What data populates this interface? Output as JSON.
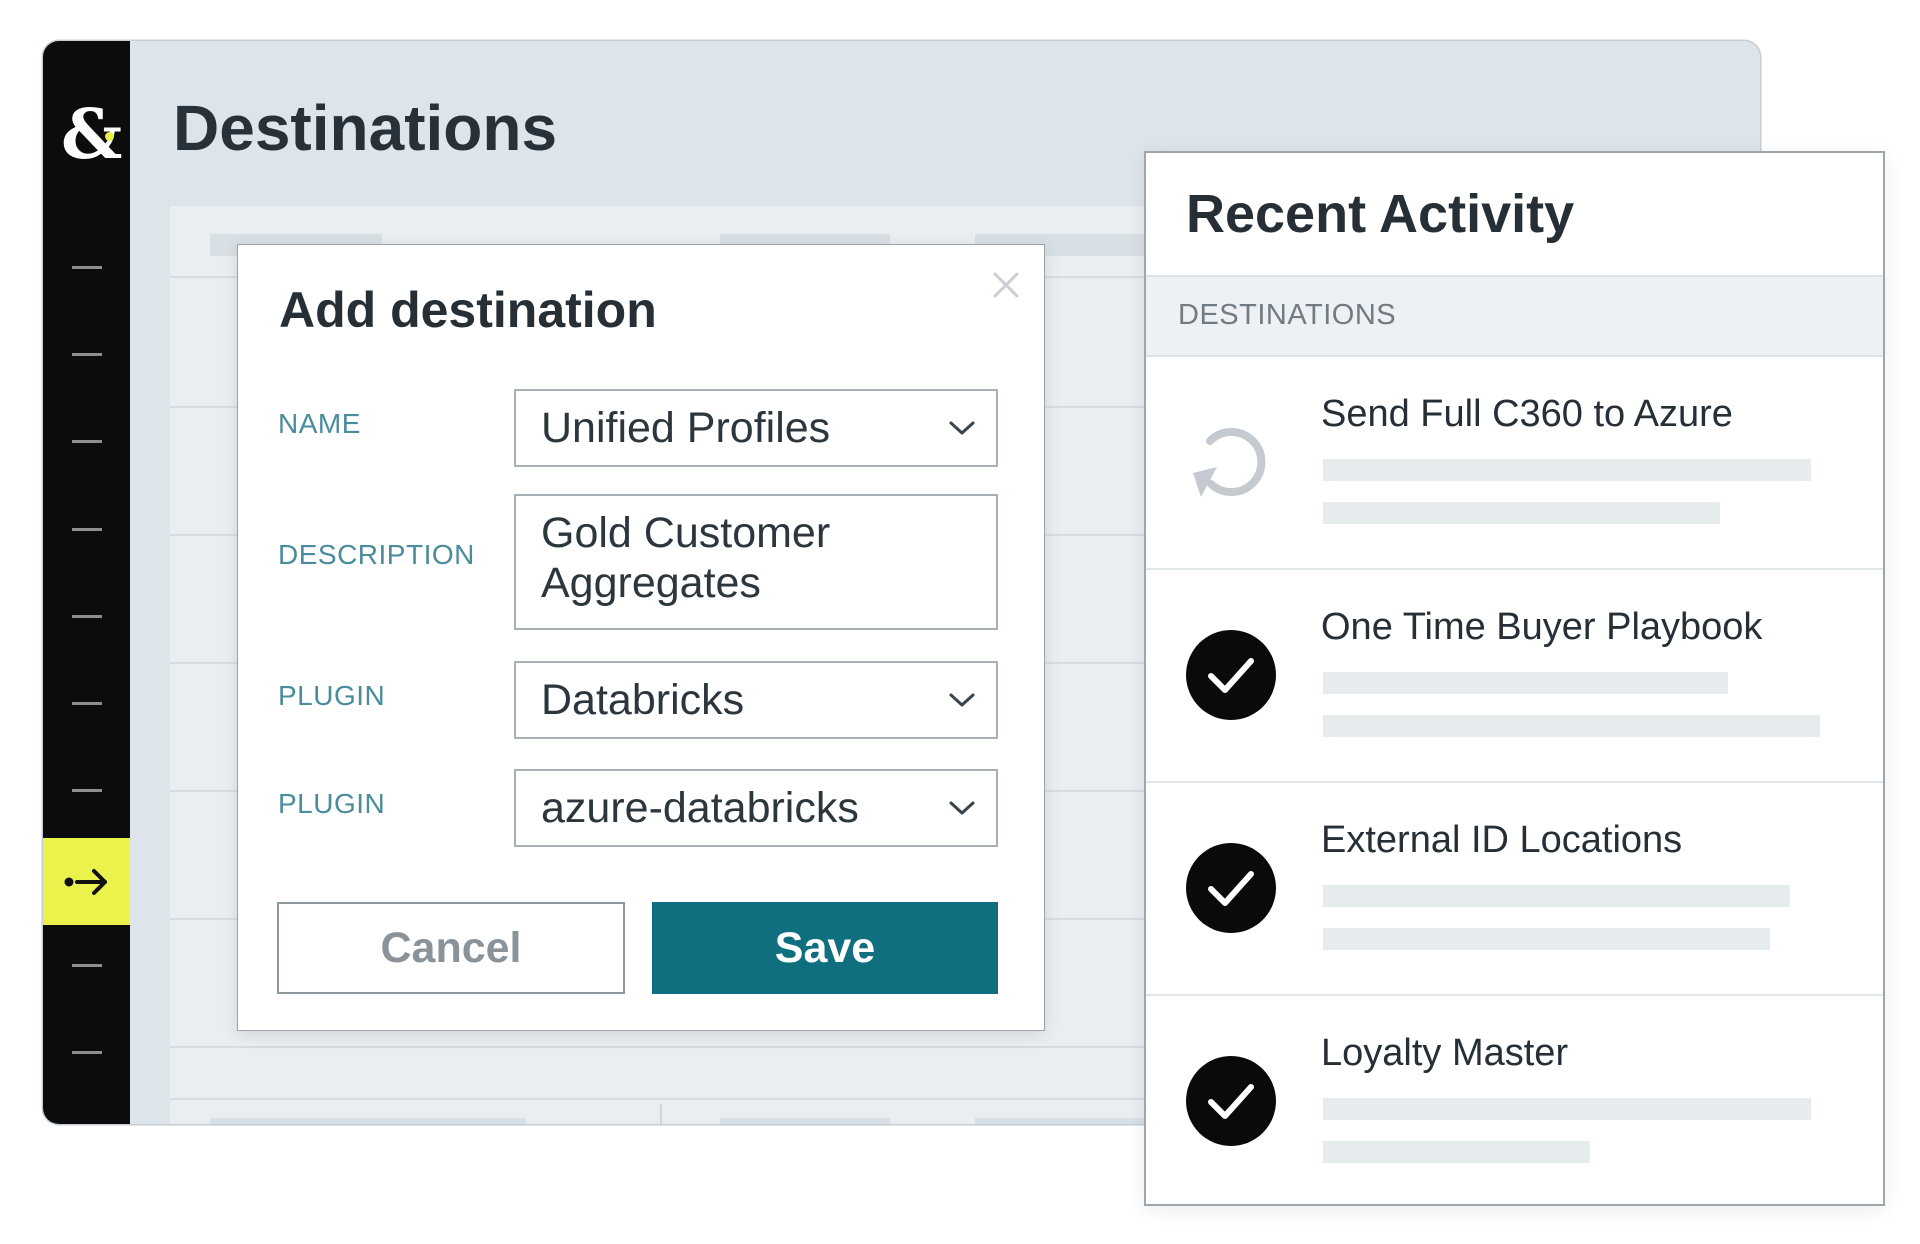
{
  "app": {
    "page_title": "Destinations",
    "logo_text": "&"
  },
  "sidebar": {
    "active_icon": "arrow-right-icon"
  },
  "modal": {
    "title": "Add destination",
    "fields": [
      {
        "label": "NAME",
        "value": "Unified Profiles",
        "type": "select"
      },
      {
        "label": "DESCRIPTION",
        "value": "Gold Customer Aggregates",
        "type": "textarea"
      },
      {
        "label": "PLUGIN",
        "value": "Databricks",
        "type": "select"
      },
      {
        "label": "PLUGIN",
        "value": "azure-databricks",
        "type": "select"
      }
    ],
    "cancel_label": "Cancel",
    "save_label": "Save"
  },
  "activity": {
    "title": "Recent Activity",
    "section_label": "DESTINATIONS",
    "items": [
      {
        "name": "Send Full C360 to Azure",
        "status": "refresh-icon"
      },
      {
        "name": "One Time Buyer Playbook",
        "status": "check-circle-icon"
      },
      {
        "name": "External ID Locations",
        "status": "check-circle-icon"
      },
      {
        "name": "Loyalty Master",
        "status": "check-circle-icon"
      }
    ]
  },
  "colors": {
    "sidebar_bg": "#0c0c0c",
    "accent_yellow": "#ecf24c",
    "save_button": "#0f6f7e",
    "label_teal": "#4a8c9c"
  }
}
